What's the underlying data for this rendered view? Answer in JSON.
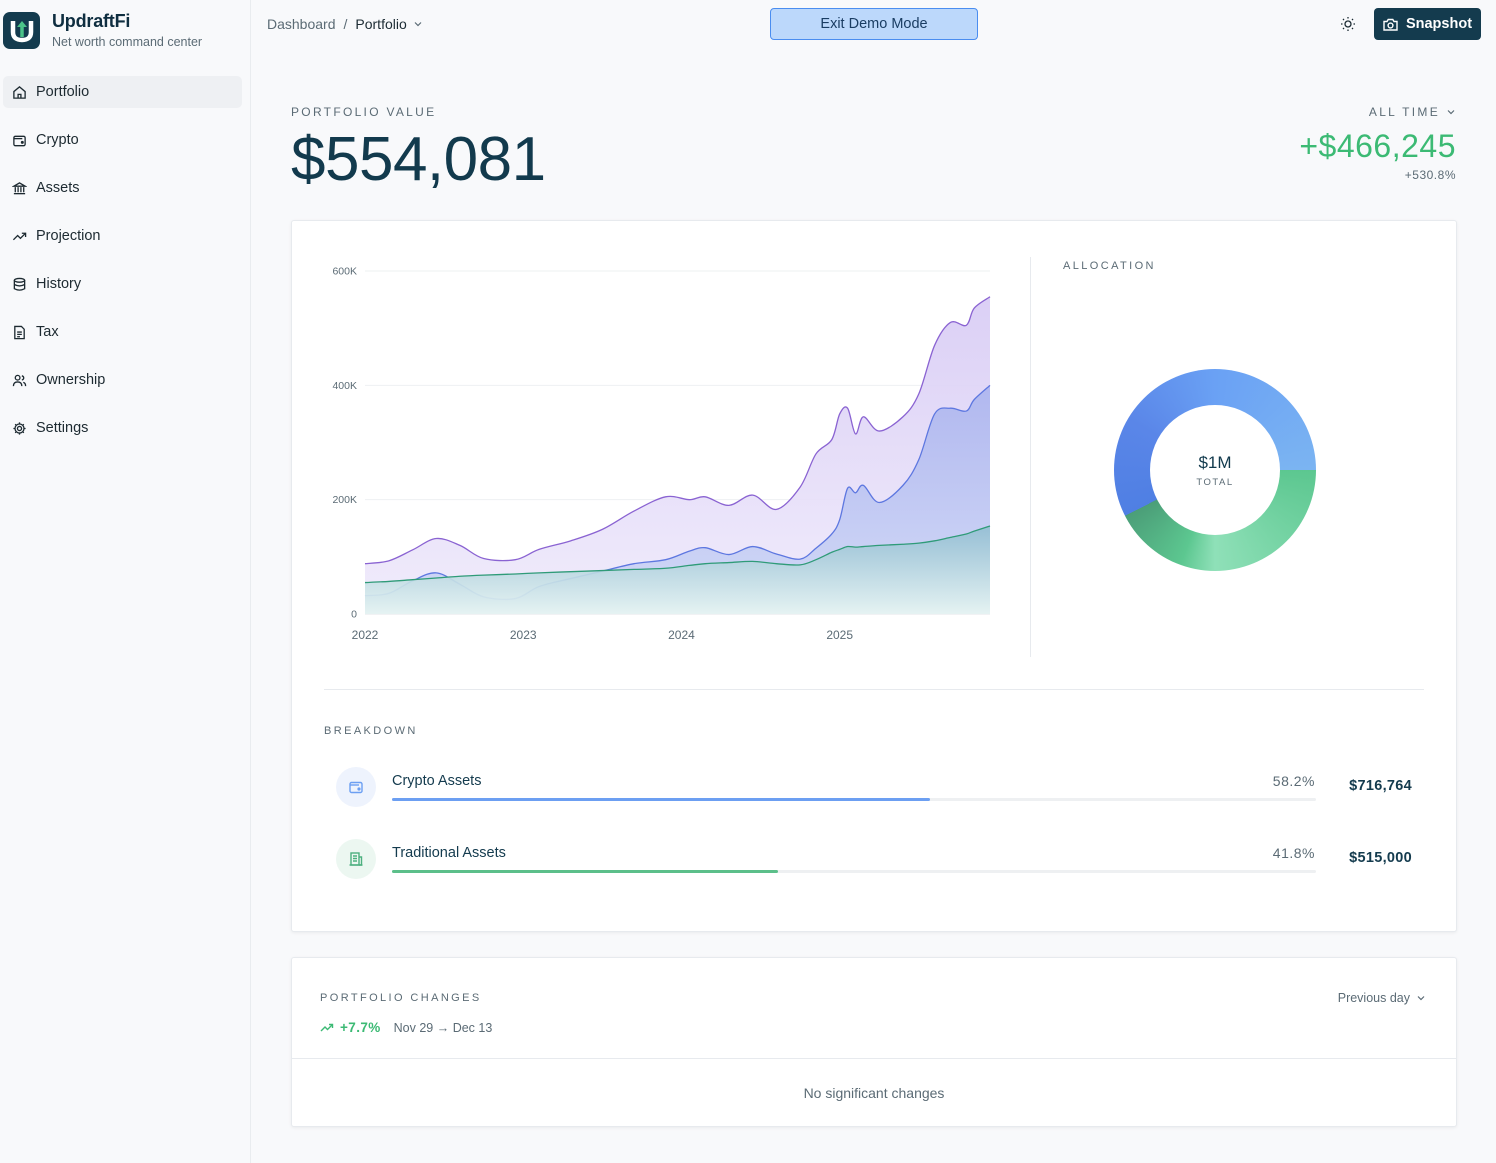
{
  "brand": {
    "name": "UpdraftFi",
    "tagline": "Net worth command center"
  },
  "nav": [
    {
      "label": "Portfolio",
      "icon": "home-icon",
      "active": true
    },
    {
      "label": "Crypto",
      "icon": "wallet-icon"
    },
    {
      "label": "Assets",
      "icon": "bank-icon"
    },
    {
      "label": "Projection",
      "icon": "trending-up-icon"
    },
    {
      "label": "History",
      "icon": "database-icon"
    },
    {
      "label": "Tax",
      "icon": "document-icon"
    },
    {
      "label": "Ownership",
      "icon": "users-icon"
    },
    {
      "label": "Settings",
      "icon": "gear-icon"
    }
  ],
  "breadcrumb": {
    "root": "Dashboard",
    "separator": "/",
    "current": "Portfolio"
  },
  "topbar": {
    "exit_demo": "Exit Demo Mode",
    "snapshot": "Snapshot"
  },
  "portfolio": {
    "label": "PORTFOLIO VALUE",
    "value": "$554,081",
    "range": "ALL TIME",
    "gain": "+$466,245",
    "gain_pct": "+530.8%"
  },
  "chart_data": {
    "type": "area",
    "x_ticks": [
      "2022",
      "2023",
      "2024",
      "2025"
    ],
    "y_ticks": [
      "0",
      "200K",
      "400K",
      "600K"
    ],
    "ylim": [
      0,
      600000
    ],
    "x": [
      2022.0,
      2022.15,
      2022.3,
      2022.45,
      2022.6,
      2022.75,
      2022.95,
      2023.1,
      2023.3,
      2023.5,
      2023.7,
      2023.9,
      2024.05,
      2024.15,
      2024.3,
      2024.45,
      2024.6,
      2024.75,
      2024.85,
      2024.95,
      2025.0,
      2025.05,
      2025.1,
      2025.15,
      2025.25,
      2025.4,
      2025.5,
      2025.6,
      2025.7,
      2025.8,
      2025.85,
      2025.95
    ],
    "series": [
      {
        "values": [
          88000,
          93000,
          112000,
          132000,
          120000,
          97000,
          95000,
          113000,
          128000,
          148000,
          180000,
          205000,
          200000,
          205000,
          190000,
          208000,
          183000,
          222000,
          280000,
          305000,
          350000,
          360000,
          315000,
          345000,
          320000,
          345000,
          385000,
          470000,
          510000,
          505000,
          535000,
          555000
        ],
        "color": "#8a63d2"
      },
      {
        "values": [
          32000,
          36000,
          58000,
          72000,
          52000,
          30000,
          27000,
          48000,
          62000,
          75000,
          88000,
          95000,
          110000,
          116000,
          104000,
          118000,
          105000,
          96000,
          115000,
          140000,
          165000,
          220000,
          212000,
          225000,
          195000,
          225000,
          270000,
          350000,
          360000,
          355000,
          375000,
          400000
        ],
        "color": "#5d77e0"
      },
      {
        "values": [
          55000,
          57000,
          60000,
          63000,
          66000,
          68000,
          70000,
          72000,
          74000,
          76000,
          78000,
          80000,
          85000,
          88000,
          90000,
          92000,
          88000,
          86000,
          95000,
          108000,
          113000,
          118000,
          117000,
          118000,
          120000,
          122000,
          124000,
          128000,
          134000,
          140000,
          145000,
          154000
        ],
        "color": "#2f9b78"
      }
    ]
  },
  "allocation": {
    "label": "ALLOCATION",
    "total": "$1M",
    "total_label": "TOTAL"
  },
  "breakdown": {
    "label": "BREAKDOWN",
    "items": [
      {
        "name": "Crypto Assets",
        "pct": "58.2%",
        "fill": 0.582,
        "amount": "$716,764",
        "color": "#6c9ff2"
      },
      {
        "name": "Traditional Assets",
        "pct": "41.8%",
        "fill": 0.418,
        "amount": "$515,000",
        "color": "#5cbf8a"
      }
    ]
  },
  "changes": {
    "label": "PORTFOLIO CHANGES",
    "pct": "+7.7%",
    "range": "Nov 29 → Dec 13",
    "period": "Previous day",
    "empty": "No significant changes"
  }
}
